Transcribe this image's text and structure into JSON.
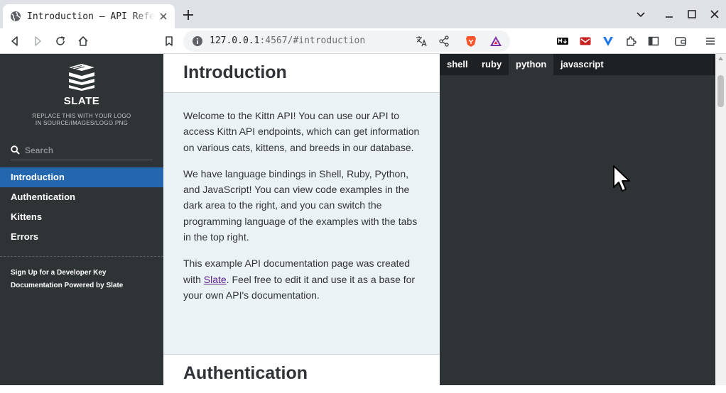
{
  "browser": {
    "tab_title": "Introduction – API Reference",
    "url_host": "127.0.0.1",
    "url_rest": ":4567/#introduction"
  },
  "sidebar": {
    "logo_name": "SLATE",
    "logo_sub_line1": "REPLACE THIS WITH YOUR LOGO",
    "logo_sub_line2": "IN SOURCE/IMAGES/LOGO.PNG",
    "search_placeholder": "Search",
    "toc": [
      {
        "label": "Introduction",
        "active": true
      },
      {
        "label": "Authentication",
        "active": false
      },
      {
        "label": "Kittens",
        "active": false
      },
      {
        "label": "Errors",
        "active": false
      }
    ],
    "footer": [
      {
        "label": "Sign Up for a Developer Key"
      },
      {
        "label": "Documentation Powered by Slate"
      }
    ]
  },
  "content": {
    "title": "Introduction",
    "para1": "Welcome to the Kittn API! You can use our API to access Kittn API endpoints, which can get information on various cats, kittens, and breeds in our database.",
    "para2": "We have language bindings in Shell, Ruby, Python, and JavaScript! You can view code examples in the dark area to the right, and you can switch the programming language of the examples with the tabs in the top right.",
    "para3_before": "This example API documentation page was created with ",
    "para3_link": "Slate",
    "para3_after": ". Feel free to edit it and use it as a base for your own API's documentation.",
    "next_title": "Authentication"
  },
  "code": {
    "tabs": [
      {
        "label": "shell",
        "active": false
      },
      {
        "label": "ruby",
        "active": false
      },
      {
        "label": "python",
        "active": true
      },
      {
        "label": "javascript",
        "active": false
      }
    ]
  },
  "colors": {
    "sidebar_bg": "#2e3336",
    "active_item": "#2467af",
    "content_bg": "#eaf2f6",
    "lang_bar_bg": "#1d2124",
    "link": "#5a1d8a"
  }
}
